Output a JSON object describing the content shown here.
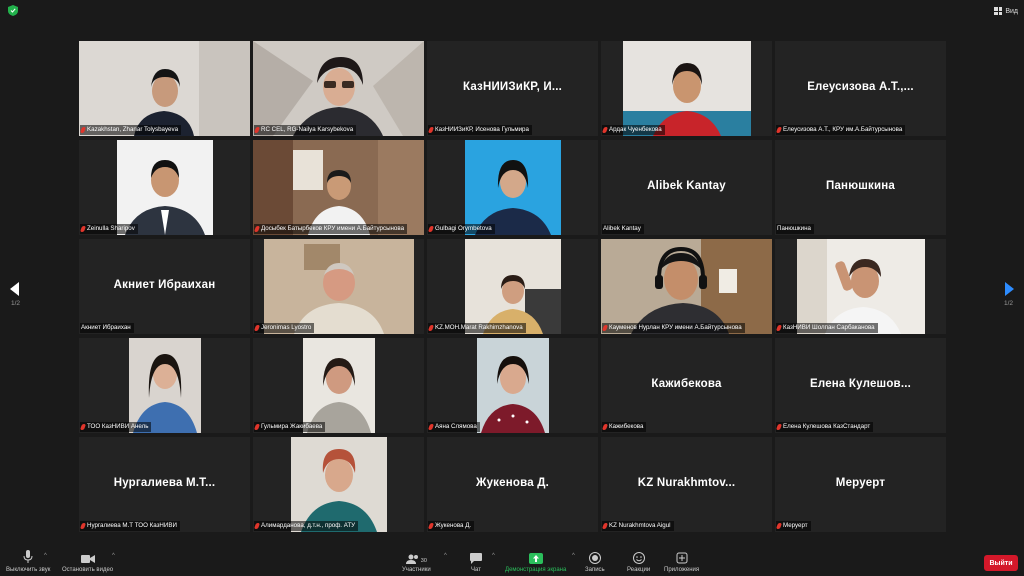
{
  "window": {
    "view_label": "Вид"
  },
  "pager": {
    "left_label": "1/2",
    "right_label": "1/2"
  },
  "tiles": [
    {
      "label": "Kazakhstan, Zhanar Tolysbayeva",
      "video": true
    },
    {
      "label": "RC CEL, RG-Nailya Karsybekova",
      "video": true,
      "active": true
    },
    {
      "name": "КазНИИЗиКР,  И...",
      "label": "КазНИИЗиКР, Исенова Гульмира"
    },
    {
      "label": "Ардак Чуенбекова",
      "video": true
    },
    {
      "name": "Елеусизова  А.Т.,...",
      "label": "Елеусизова А.Т., КРУ им.А.Байтурсынова"
    },
    {
      "label": "Zeinulla Sharipov",
      "video": true
    },
    {
      "label": "Досыбек Батырбеков КРУ имени А.Байтурсынова",
      "video": true
    },
    {
      "label": "Gulbagi Orymbetova",
      "video": true
    },
    {
      "name": "Alibek Kantay",
      "label": "Alibek Kantay"
    },
    {
      "name": "Панюшкина",
      "label": "Панюшкина"
    },
    {
      "name": "Акниет Ибраихан",
      "label": "Акниет Ибраихан"
    },
    {
      "label": "Jeronimas Lyostro",
      "video": true
    },
    {
      "label": "KZ.MOH.Marat Rakhimzhanova",
      "video": true
    },
    {
      "label": "Кауменов Нурлан КРУ имени А.Байтурсынова",
      "video": true
    },
    {
      "label": "КазНИВИ Шолпан Сарбаканова",
      "video": true
    },
    {
      "label": "ТОО КазНИВИ Анель",
      "video": true
    },
    {
      "label": "Гульмира Жакибаева",
      "video": true
    },
    {
      "label": "Аяна Слямова",
      "video": true
    },
    {
      "name": "Кажибекова",
      "label": "Кажибекова"
    },
    {
      "name": "Елена  Кулешов...",
      "label": "Елена Кулешова КазСтандарт"
    },
    {
      "name": "Нургалиева  М.Т...",
      "label": "Нургалиева М.Т ТОО КазНИВИ"
    },
    {
      "label": "Алимарданова, д.т.н., проф. АТУ",
      "video": true
    },
    {
      "name": "Жукенова  Д.",
      "label": "Жукенова Д."
    },
    {
      "name": "KZ  Nurakhmtov...",
      "label": "KZ Nurakhmtova Aigul"
    },
    {
      "name": "Меруерт",
      "label": "Меруерт"
    }
  ],
  "toolbar": {
    "mute": "Выключить звук",
    "video": "Остановить видео",
    "participants": "Участники",
    "participants_count": "30",
    "chat": "Чат",
    "share": "Демонстрация экрана",
    "record": "Запись",
    "reactions": "Реакции",
    "apps": "Приложения",
    "leave": "Выйти"
  }
}
